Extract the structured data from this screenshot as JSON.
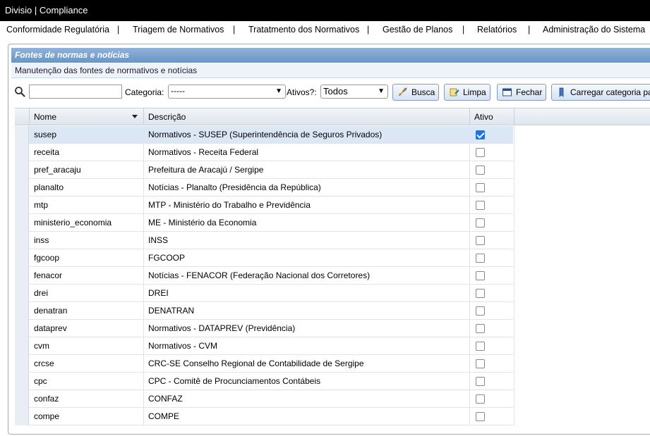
{
  "app": {
    "title": "Divisio | Compliance"
  },
  "menu": {
    "items": [
      "Conformidade Regulatória",
      "Triagem de Normativos",
      "Tratatmento dos Normativos",
      "Gestão de Planos",
      "Relatórios",
      "Administração do Sistema"
    ],
    "separator": "|"
  },
  "panel": {
    "title": "Fontes de normas e notícias",
    "subtitle": "Manutenção das fontes de normativos e notícias"
  },
  "toolbar": {
    "search_value": "",
    "categoria_label": "Categoria:",
    "categoria_value": "-----",
    "ativos_label": "Ativos?:",
    "ativos_value": "Todos",
    "busca_label": "Busca",
    "limpa_label": "Limpa",
    "fechar_label": "Fechar",
    "carregar_label": "Carregar categoria pa"
  },
  "grid": {
    "columns": {
      "nome": "Nome",
      "descricao": "Descrição",
      "ativo": "Ativo"
    },
    "rows": [
      {
        "nome": "susep",
        "descricao": "Normativos - SUSEP (Superintendência de Seguros Privados)",
        "ativo": true
      },
      {
        "nome": "receita",
        "descricao": "Normativos - Receita Federal",
        "ativo": false
      },
      {
        "nome": "pref_aracaju",
        "descricao": "Prefeitura de Aracajú / Sergipe",
        "ativo": false
      },
      {
        "nome": "planalto",
        "descricao": "Notícias - Planalto (Presidência da República)",
        "ativo": false
      },
      {
        "nome": "mtp",
        "descricao": "MTP - Ministério do Trabalho e Previdência",
        "ativo": false
      },
      {
        "nome": "ministerio_economia",
        "descricao": "ME - Ministério da Economia",
        "ativo": false
      },
      {
        "nome": "inss",
        "descricao": "INSS",
        "ativo": false
      },
      {
        "nome": "fgcoop",
        "descricao": "FGCOOP",
        "ativo": false
      },
      {
        "nome": "fenacor",
        "descricao": "Notícias - FENACOR (Federação Nacional dos Corretores)",
        "ativo": false
      },
      {
        "nome": "drei",
        "descricao": "DREI",
        "ativo": false
      },
      {
        "nome": "denatran",
        "descricao": "DENATRAN",
        "ativo": false
      },
      {
        "nome": "dataprev",
        "descricao": "Normativos - DATAPREV (Previdência)",
        "ativo": false
      },
      {
        "nome": "cvm",
        "descricao": "Normativos - CVM",
        "ativo": false
      },
      {
        "nome": "crcse",
        "descricao": "CRC-SE Conselho Regional de Contabilidade de Sergipe",
        "ativo": false
      },
      {
        "nome": "cpc",
        "descricao": "CPC - Comitê de Procunciamentos Contábeis",
        "ativo": false
      },
      {
        "nome": "confaz",
        "descricao": "CONFAZ",
        "ativo": false
      },
      {
        "nome": "compe",
        "descricao": "COMPE",
        "ativo": false
      }
    ]
  },
  "colors": {
    "header_blue": "#6b95c6",
    "selected_row": "#dce7f5",
    "checkbox_on": "#1a73e8"
  }
}
